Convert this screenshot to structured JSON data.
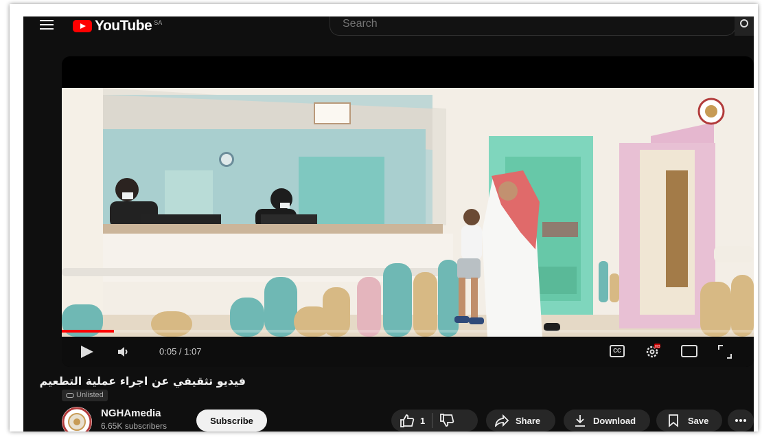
{
  "header": {
    "logo_text": "YouTube",
    "logo_suffix": "SA",
    "search_placeholder": "Search"
  },
  "player": {
    "time_display": "0:05 / 1:07",
    "progress_fraction": 0.075,
    "cc_label": "CC",
    "hd_badge": "HD"
  },
  "video": {
    "title": "فيديو تثقيفي عن اجراء عملية التطعيم",
    "visibility": "Unlisted"
  },
  "channel": {
    "name": "NGHAmedia",
    "subscribers": "6.65K subscribers",
    "subscribe_label": "Subscribe"
  },
  "actions": {
    "like_count": "1",
    "share_label": "Share",
    "download_label": "Download",
    "save_label": "Save"
  },
  "colors": {
    "brand_red": "#ff0000",
    "background": "#0f0f0f",
    "pill": "#272727"
  }
}
